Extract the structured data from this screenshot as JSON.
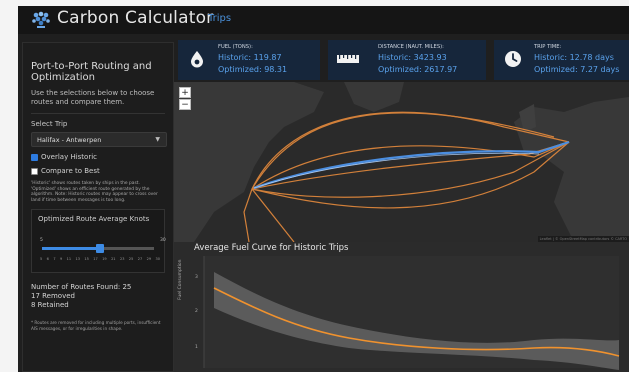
{
  "header": {
    "title": "Carbon Calculator",
    "nav_trips": "Trips"
  },
  "sidebar": {
    "title": "Port-to-Port Routing and Optimization",
    "description": "Use the selections below to choose routes and compare them.",
    "select_trip_label": "Select Trip",
    "selected_trip": "Halifax - Antwerpen",
    "overlay_historic_label": "Overlay Historic",
    "overlay_historic_checked": true,
    "compare_best_label": "Compare to Best",
    "compare_best_checked": false,
    "note": "'Historic' shows routes taken by ships in the past. 'Optimized' shows an efficient route generated by the algorithm. Note: Historic routes may appear to cross over land if time between messages is too long.",
    "slider": {
      "title": "Optimized Route Average Knots",
      "min_label": "5",
      "max_label": "30",
      "value_fraction": 0.52,
      "ticks": [
        "5",
        "6",
        "7",
        "9",
        "11",
        "13",
        "15",
        "17",
        "19",
        "21",
        "23",
        "25",
        "27",
        "29",
        "30"
      ]
    },
    "stats": {
      "routes_found": "Number of Routes Found: 25",
      "removed": "17 Removed",
      "retained": "8 Retained"
    },
    "footnote": "* Routes are removed for including multiple ports, insufficient AIS messages, or for irregularities in shape."
  },
  "cards": [
    {
      "icon": "fuel-drop-icon",
      "title": "FUEL (TONS):",
      "historic": "Historic: 119.87",
      "optimized": "Optimized: 98.31"
    },
    {
      "icon": "ruler-icon",
      "title": "DISTANCE (NAUT. MILES):",
      "historic": "Historic: 3423.93",
      "optimized": "Optimized: 2617.97"
    },
    {
      "icon": "clock-icon",
      "title": "TRIP TIME:",
      "historic": "Historic: 12.78 days",
      "optimized": "Optimized: 7.27 days"
    }
  ],
  "map": {
    "zoom_in": "+",
    "zoom_out": "−",
    "attribution": "Leaflet | © OpenStreetMap contributors © CARTO",
    "colors": {
      "historic": "#e58a3c",
      "optimized": "#4b8ee0",
      "land": "#3a3a3a",
      "sea": "#262626"
    }
  },
  "fuel_chart": {
    "title": "Average Fuel Curve for Historic Trips",
    "ylabel": "Fuel Consumption",
    "y_ticks": [
      "3",
      "2",
      "1"
    ],
    "colors": {
      "line": "#f0922e",
      "band": "#6b6b6b"
    }
  }
}
